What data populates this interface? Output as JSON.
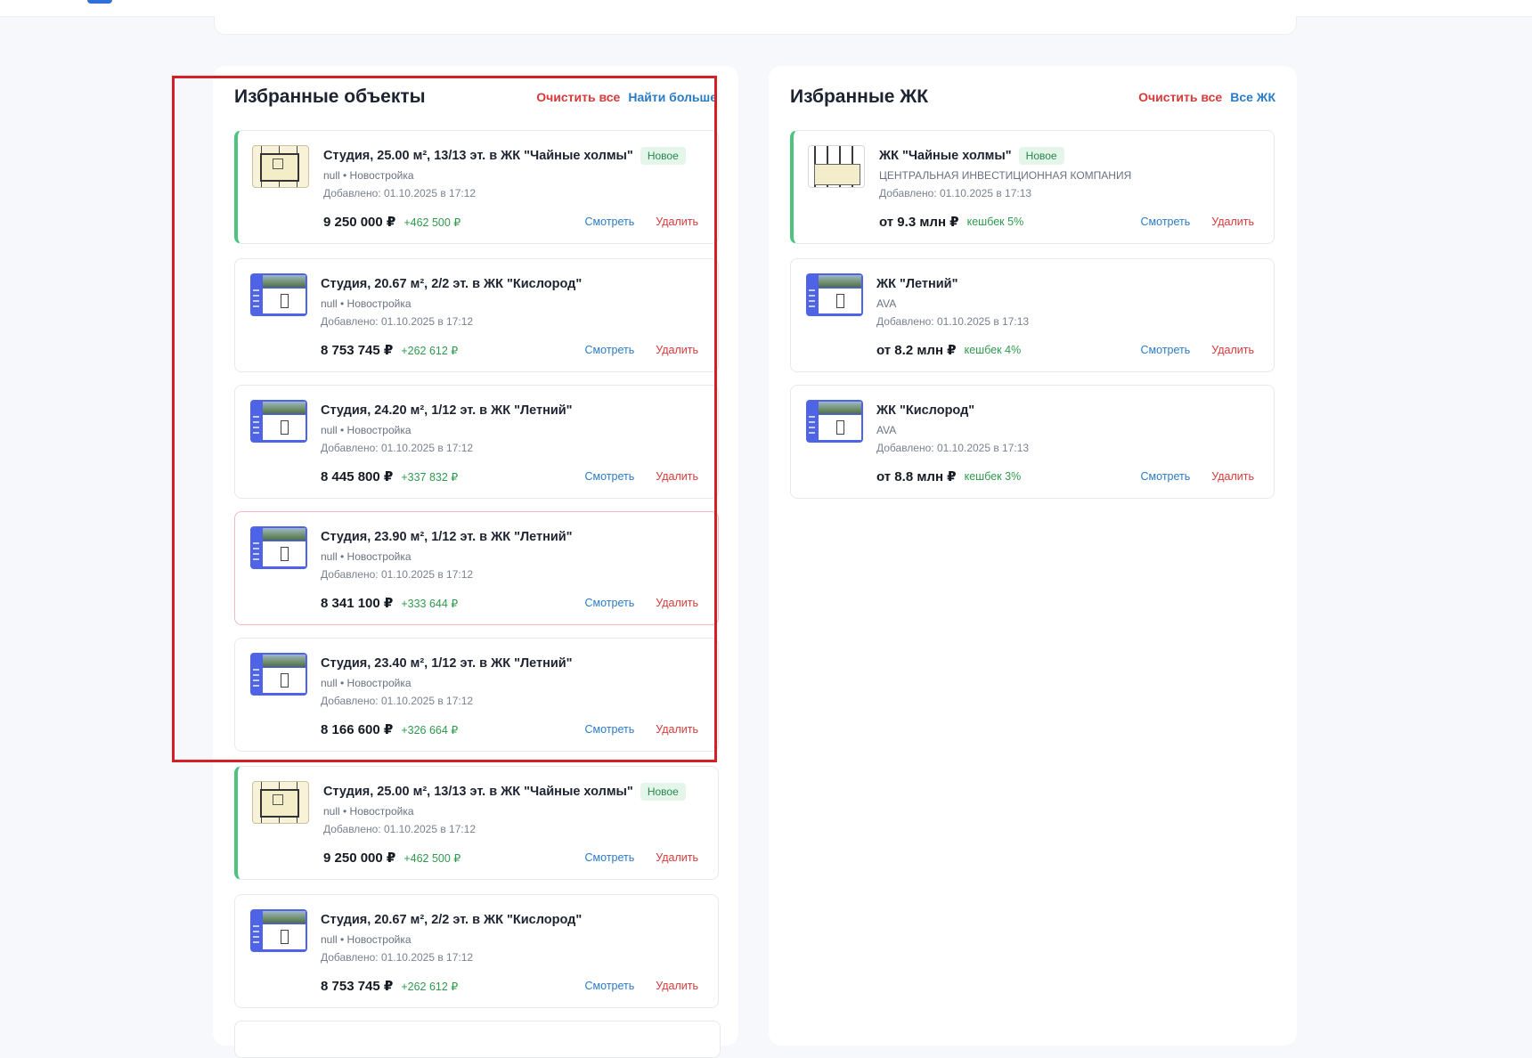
{
  "favorites_objects": {
    "title": "Избранные объекты",
    "clear_label": "Очистить все",
    "more_label": "Найти больше",
    "items": [
      {
        "title": "Студия, 25.00 м², 13/13 эт. в ЖК \"Чайные холмы\"",
        "badge": "Новое",
        "sub": "null • Новостройка",
        "added": "Добавлено: 01.10.2025 в 17:12",
        "price": "9 250 000 ₽",
        "delta": "+462 500 ₽",
        "view": "Смотреть",
        "delete": "Удалить",
        "thumb": "floorplan-thumbnail",
        "accent": "new"
      },
      {
        "title": "Студия, 20.67 м², 2/2 эт. в ЖК \"Кислород\"",
        "sub": "null • Новостройка",
        "added": "Добавлено: 01.10.2025 в 17:12",
        "price": "8 753 745 ₽",
        "delta": "+262 612 ₽",
        "view": "Смотреть",
        "delete": "Удалить",
        "thumb": "blue-layout-thumbnail"
      },
      {
        "title": "Студия, 24.20 м², 1/12 эт. в ЖК \"Летний\"",
        "sub": "null • Новостройка",
        "added": "Добавлено: 01.10.2025 в 17:12",
        "price": "8 445 800 ₽",
        "delta": "+337 832 ₽",
        "view": "Смотреть",
        "delete": "Удалить",
        "thumb": "blue-layout-thumbnail"
      },
      {
        "title": "Студия, 23.90 м², 1/12 эт. в ЖК \"Летний\"",
        "sub": "null • Новостройка",
        "added": "Добавлено: 01.10.2025 в 17:12",
        "price": "8 341 100 ₽",
        "delta": "+333 644 ₽",
        "view": "Смотреть",
        "delete": "Удалить",
        "thumb": "blue-layout-thumbnail",
        "accent": "hover"
      },
      {
        "title": "Студия, 23.40 м², 1/12 эт. в ЖК \"Летний\"",
        "sub": "null • Новостройка",
        "added": "Добавлено: 01.10.2025 в 17:12",
        "price": "8 166 600 ₽",
        "delta": "+326 664 ₽",
        "view": "Смотреть",
        "delete": "Удалить",
        "thumb": "blue-layout-thumbnail"
      },
      {
        "title": "Студия, 25.00 м², 13/13 эт. в ЖК \"Чайные холмы\"",
        "badge": "Новое",
        "sub": "null • Новостройка",
        "added": "Добавлено: 01.10.2025 в 17:12",
        "price": "9 250 000 ₽",
        "delta": "+462 500 ₽",
        "view": "Смотреть",
        "delete": "Удалить",
        "thumb": "floorplan-thumbnail",
        "accent": "new"
      },
      {
        "title": "Студия, 20.67 м², 2/2 эт. в ЖК \"Кислород\"",
        "sub": "null • Новостройка",
        "added": "Добавлено: 01.10.2025 в 17:12",
        "price": "8 753 745 ₽",
        "delta": "+262 612 ₽",
        "view": "Смотреть",
        "delete": "Удалить",
        "thumb": "blue-layout-thumbnail"
      }
    ]
  },
  "favorites_complexes": {
    "title": "Избранные ЖК",
    "clear_label": "Очистить все",
    "more_label": "Все ЖК",
    "items": [
      {
        "title": "ЖК \"Чайные холмы\"",
        "badge": "Новое",
        "sub": "ЦЕНТРАЛЬНАЯ ИНВЕСТИЦИОННАЯ КОМПАНИЯ",
        "added": "Добавлено: 01.10.2025 в 17:13",
        "price": "от 9.3 млн ₽",
        "delta": "кешбек 5%",
        "view": "Смотреть",
        "delete": "Удалить",
        "thumb": "complex-plan-thumbnail",
        "accent": "new"
      },
      {
        "title": "ЖК \"Летний\"",
        "sub": "AVA",
        "added": "Добавлено: 01.10.2025 в 17:13",
        "price": "от 8.2 млн ₽",
        "delta": "кешбек 4%",
        "view": "Смотреть",
        "delete": "Удалить",
        "thumb": "blue-layout-thumbnail"
      },
      {
        "title": "ЖК \"Кислород\"",
        "sub": "AVA",
        "added": "Добавлено: 01.10.2025 в 17:13",
        "price": "от 8.8 млн ₽",
        "delta": "кешбек 3%",
        "view": "Смотреть",
        "delete": "Удалить",
        "thumb": "blue-layout-thumbnail"
      }
    ]
  },
  "colors": {
    "accent_new": "#4dc47e",
    "delete_red": "#d63a3a",
    "link_blue": "#2a7bc4",
    "delta_green": "#2e9a4c",
    "highlight_red": "#d51f27"
  }
}
